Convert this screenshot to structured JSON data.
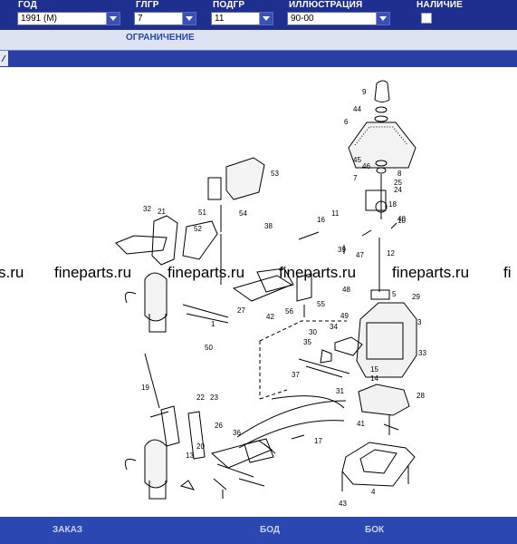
{
  "header": {
    "year": {
      "label": "ГОД",
      "value": "1991 (M)"
    },
    "group": {
      "label": "ГЛГР",
      "value": "7"
    },
    "subgroup": {
      "label": "ПОДГР",
      "value": "11"
    },
    "illustration": {
      "label": "ИЛЛЮСТРАЦИЯ",
      "value": "90-00"
    },
    "availability": {
      "label": "НАЛИЧИЕ"
    }
  },
  "restriction_label": "ОГРАНИЧЕНИЕ",
  "watermarks": [
    "s.ru",
    "fineparts.ru",
    "fineparts.ru",
    "fineparts.ru",
    "fineparts.ru",
    "fi"
  ],
  "footer": {
    "order": "ЗАКАЗ",
    "left_side": "БОД",
    "side": "БОК"
  },
  "callouts": [
    "1",
    "3",
    "4",
    "5",
    "6",
    "7",
    "8",
    "9",
    "10",
    "11",
    "12",
    "13",
    "14",
    "15",
    "16",
    "17",
    "18",
    "19",
    "20",
    "21",
    "22",
    "23",
    "24",
    "25",
    "26",
    "27",
    "28",
    "29",
    "30",
    "31",
    "32",
    "33",
    "34",
    "35",
    "36",
    "37",
    "38",
    "39",
    "40",
    "41",
    "42",
    "43",
    "44",
    "45",
    "46",
    "47",
    "48",
    "49",
    "50",
    "51",
    "52",
    "53",
    "54",
    "55",
    "56"
  ]
}
